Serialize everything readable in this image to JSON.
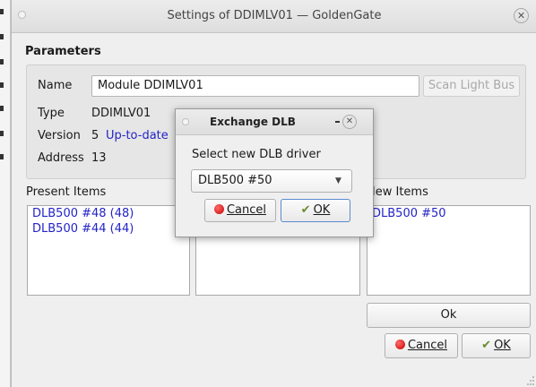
{
  "window": {
    "title": "Settings of DDIMLV01 — GoldenGate",
    "close_glyph": "✕"
  },
  "parameters": {
    "section_title": "Parameters",
    "name_label": "Name",
    "name_value": "Module DDIMLV01",
    "scan_button": "Scan Light Bus",
    "type_label": "Type",
    "type_value": "DDIMLV01",
    "version_label": "Version",
    "version_value": "5",
    "version_status": "Up-to-date",
    "address_label": "Address",
    "address_value": "13"
  },
  "present_items": {
    "label": "Present Items",
    "items": [
      "DLB500 #48 (48)",
      "DLB500 #44 (44)"
    ]
  },
  "new_items": {
    "label": "New Items",
    "items": [
      "DLB500 #50"
    ]
  },
  "footer": {
    "ok_wide": "Ok",
    "cancel": "Cancel",
    "ok": "OK"
  },
  "dialog": {
    "title": "Exchange DLB",
    "prompt": "Select new DLB driver",
    "selected": "DLB500 #50",
    "cancel": "Cancel",
    "ok": "OK"
  }
}
